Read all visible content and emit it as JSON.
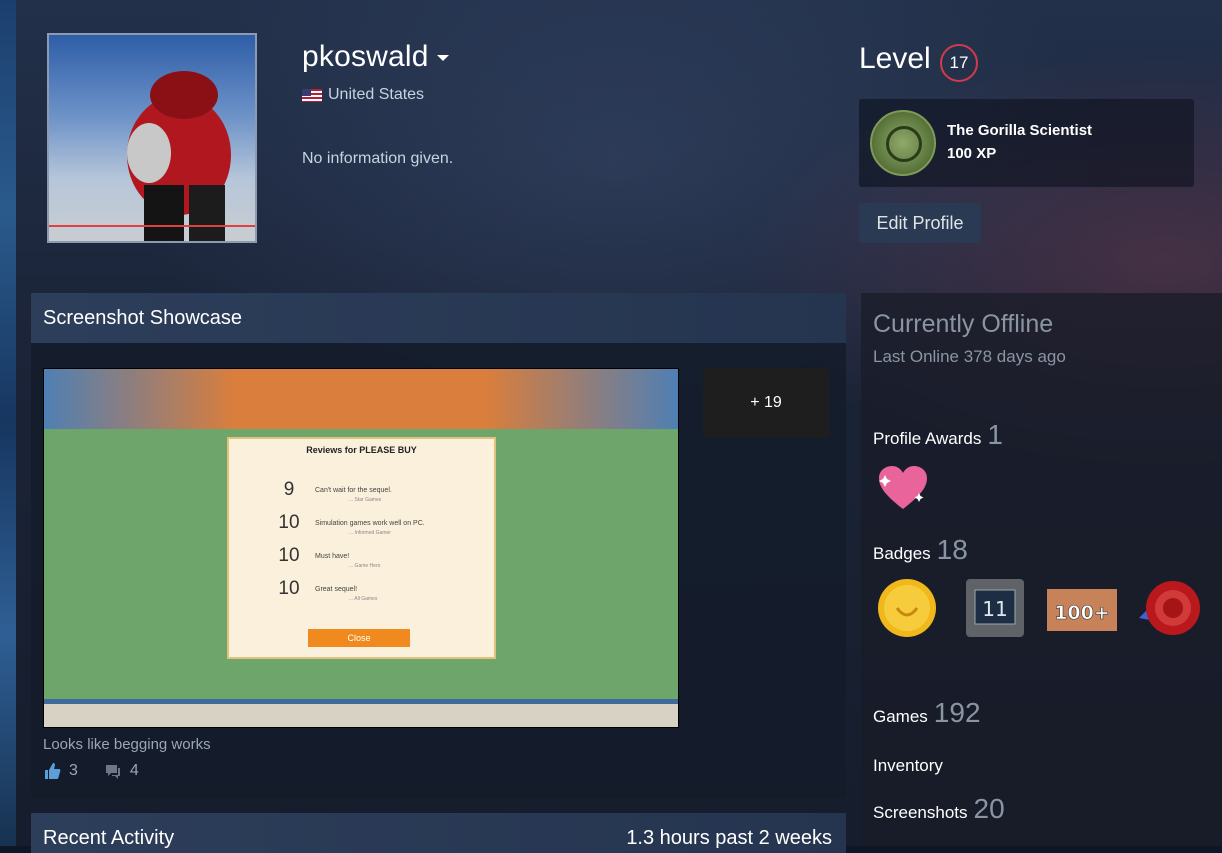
{
  "profile": {
    "persona_name": "pkoswald",
    "country": "United States",
    "summary": "No information given."
  },
  "level": {
    "label": "Level",
    "value": "17"
  },
  "favorite_badge": {
    "name": "The Gorilla Scientist",
    "xp": "100 XP"
  },
  "edit_profile_label": "Edit Profile",
  "showcase": {
    "title": "Screenshot Showcase",
    "more_label": "+ 19",
    "caption": "Looks like begging works",
    "likes": "3",
    "comments": "4",
    "screenshot": {
      "panel_title": "Reviews for PLEASE BUY",
      "reviews": [
        {
          "score": "9",
          "text": "Can't wait for the sequel.",
          "source": "... Star Games"
        },
        {
          "score": "10",
          "text": "Simulation games work well on PC.",
          "source": "... Informed Gamer"
        },
        {
          "score": "10",
          "text": "Must have!",
          "source": "... Game Hero"
        },
        {
          "score": "10",
          "text": "Great sequel!",
          "source": "... All Games"
        }
      ],
      "close_label": "Close"
    }
  },
  "recent_activity": {
    "title": "Recent Activity",
    "hours": "1.3 hours past 2 weeks"
  },
  "status": {
    "state": "Currently Offline",
    "last_online": "Last Online 378 days ago"
  },
  "profile_awards": {
    "label": "Profile Awards",
    "count": "1"
  },
  "badges": {
    "label": "Badges",
    "count": "18",
    "items": [
      "gold-coin-badge-icon",
      "eleven-badge-icon",
      "hundred-plus-badge-icon",
      "red-seal-badge-icon"
    ]
  },
  "badge_11_text": "11",
  "badge_100_text": "100+",
  "games": {
    "label": "Games",
    "count": "192"
  },
  "inventory": {
    "label": "Inventory"
  },
  "screenshots": {
    "label": "Screenshots",
    "count": "20"
  }
}
